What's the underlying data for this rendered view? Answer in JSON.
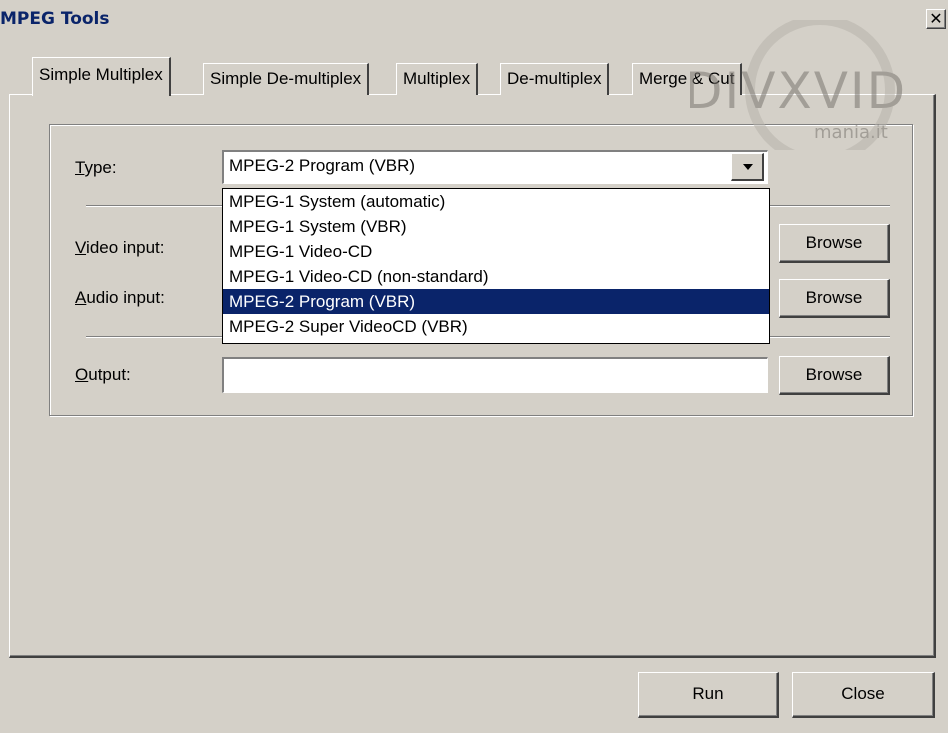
{
  "window": {
    "title": "MPEG Tools",
    "close_glyph": "✕"
  },
  "tabs": [
    {
      "label": "Simple Multiplex",
      "active": true
    },
    {
      "label": "Simple De-multiplex",
      "active": false
    },
    {
      "label": "Multiplex",
      "active": false
    },
    {
      "label": "De-multiplex",
      "active": false
    },
    {
      "label": "Merge & Cut",
      "active": false
    }
  ],
  "form": {
    "type": {
      "label_accel": "T",
      "label_rest": "ype:",
      "value": "MPEG-2 Program (VBR)"
    },
    "video_input": {
      "label_accel": "V",
      "label_rest": "ideo input:",
      "value": ""
    },
    "audio_input": {
      "label_accel": "A",
      "label_rest": "udio input:",
      "value": ""
    },
    "output": {
      "label_accel": "O",
      "label_rest": "utput:",
      "value": ""
    },
    "browse_label": "Browse"
  },
  "dropdown": {
    "options": [
      "MPEG-1 System (automatic)",
      "MPEG-1 System (VBR)",
      "MPEG-1 Video-CD",
      "MPEG-1 Video-CD (non-standard)",
      "MPEG-2 Program (VBR)",
      "MPEG-2 Super VideoCD (VBR)"
    ],
    "selected_index": 4
  },
  "footer": {
    "run_label": "Run",
    "close_label": "Close"
  },
  "watermark": {
    "text_main": "DIVXVID",
    "text_sub": "mania.it"
  },
  "colors": {
    "face": "#d4d0c8",
    "selection": "#0a246a",
    "title_text": "#0a246a"
  }
}
